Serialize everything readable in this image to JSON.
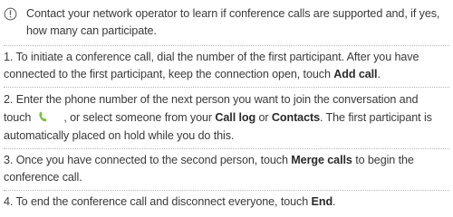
{
  "note": {
    "icon": "info-icon",
    "text": "Contact your network operator to learn if conference calls are supported and, if yes, how many can participate."
  },
  "steps": [
    {
      "num": "1.",
      "pre": "To initiate a conference call, dial the number of the first participant. After you have connected to the first participant, keep the connection open, touch ",
      "bold1": "Add call",
      "post": "."
    },
    {
      "num": "2.",
      "pre": "Enter the phone number of the next person you want to join the conversation and touch",
      "icon": "phone-icon",
      "mid": ", or select someone from your ",
      "bold1": "Call log",
      "or": " or ",
      "bold2": "Contacts",
      "post": ". The first participant is automatically placed on hold while you do this."
    },
    {
      "num": "3.",
      "pre": "Once you have connected to the second person, touch ",
      "bold1": "Merge calls",
      "post": " to begin the conference call."
    },
    {
      "num": "4.",
      "pre": "To end the conference call and disconnect everyone, touch ",
      "bold1": "End",
      "post": "."
    }
  ],
  "colors": {
    "text": "#3a3a3a",
    "icon_outline": "#5a5a5a",
    "phone_icon": "#7cc242",
    "separator": "#b8b8b8"
  }
}
